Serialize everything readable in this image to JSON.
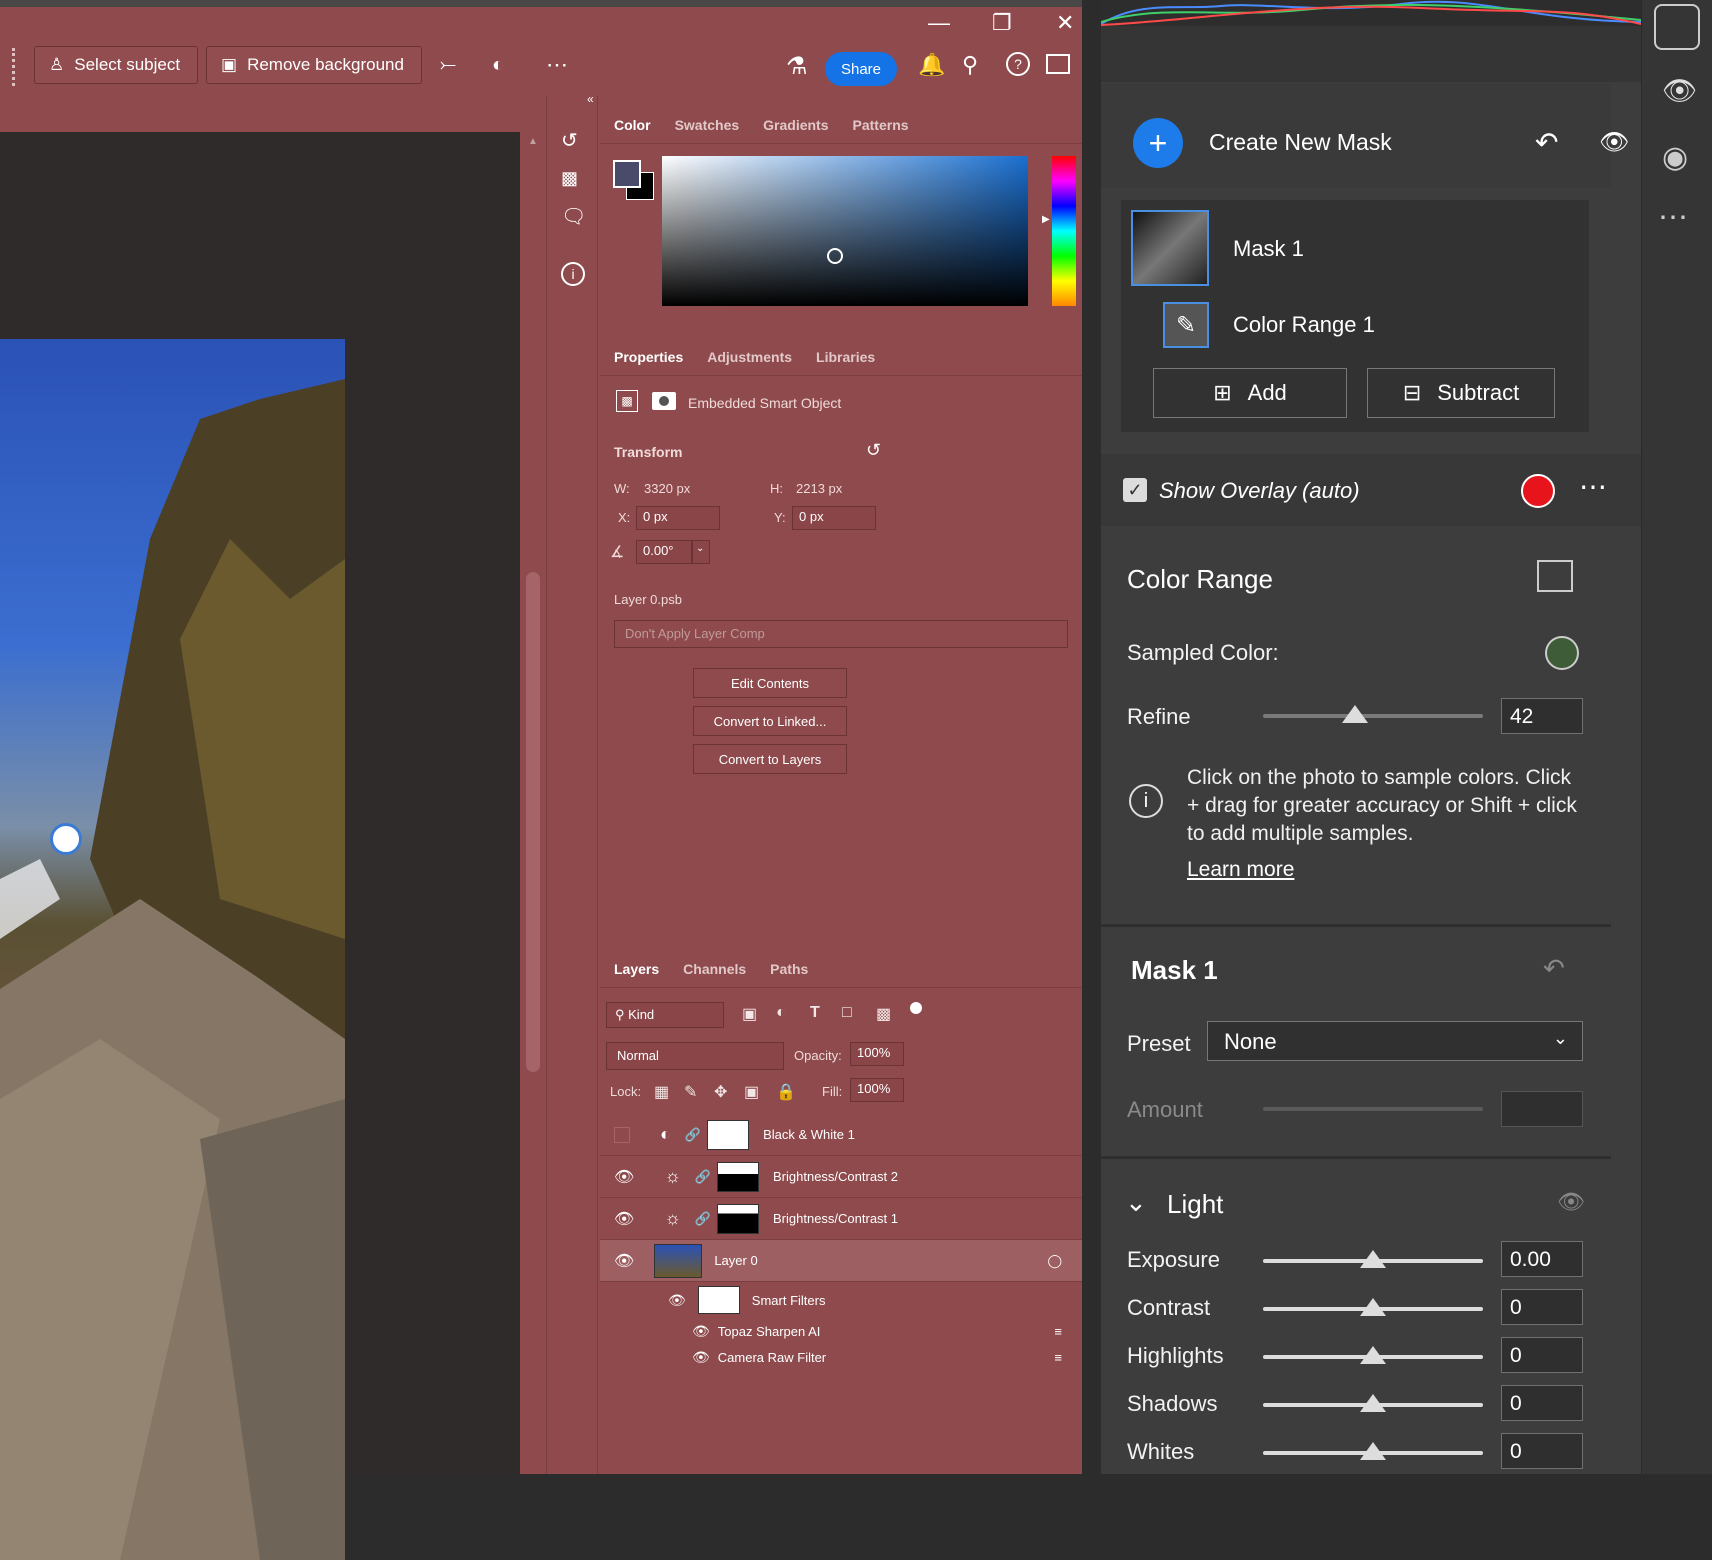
{
  "window": {
    "minimize": "—",
    "restore": "❐",
    "close": "✕"
  },
  "toolbar": {
    "select_subject": "Select subject",
    "remove_background": "Remove background",
    "share": "Share"
  },
  "color_panel": {
    "tabs": [
      "Color",
      "Swatches",
      "Gradients",
      "Patterns"
    ]
  },
  "properties": {
    "tabs": [
      "Properties",
      "Adjustments",
      "Libraries"
    ],
    "type": "Embedded Smart Object",
    "transform_label": "Transform",
    "w_label": "W:",
    "w": "3320 px",
    "h_label": "H:",
    "h": "2213 px",
    "x_label": "X:",
    "x": "0 px",
    "y_label": "Y:",
    "y": "0 px",
    "angle": "0.00°",
    "file": "Layer 0.psb",
    "layer_comp": "Don't Apply Layer Comp",
    "buttons": [
      "Edit Contents",
      "Convert to Linked...",
      "Convert to Layers"
    ]
  },
  "layers": {
    "tabs": [
      "Layers",
      "Channels",
      "Paths"
    ],
    "filter": "Kind",
    "blend": "Normal",
    "opacity_label": "Opacity:",
    "opacity": "100%",
    "lock_label": "Lock:",
    "fill_label": "Fill:",
    "fill": "100%",
    "items": [
      "Black & White 1",
      "Brightness/Contrast 2",
      "Brightness/Contrast 1",
      "Layer 0"
    ],
    "smart_filters": "Smart Filters",
    "filters": [
      "Topaz Sharpen AI",
      "Camera Raw Filter"
    ]
  },
  "camera_raw": {
    "create_mask": "Create New Mask",
    "mask_name": "Mask 1",
    "component": "Color Range 1",
    "add": "Add",
    "subtract": "Subtract",
    "overlay": "Show Overlay (auto)",
    "overlay_color": "#e8141b",
    "color_range_title": "Color Range",
    "sampled_label": "Sampled Color:",
    "sampled_color": "#3f5c38",
    "refine_label": "Refine",
    "refine_value": "42",
    "refine_fraction": 0.42,
    "info": "Click on the photo to sample colors. Click + drag for greater accuracy or Shift + click to add multiple samples.",
    "learn_more": "Learn more",
    "mask_section": "Mask 1",
    "preset_label": "Preset",
    "preset_value": "None",
    "amount_label": "Amount",
    "light_label": "Light",
    "sliders": [
      {
        "label": "Exposure",
        "value": "0.00",
        "fraction": 0.5
      },
      {
        "label": "Contrast",
        "value": "0",
        "fraction": 0.5
      },
      {
        "label": "Highlights",
        "value": "0",
        "fraction": 0.5
      },
      {
        "label": "Shadows",
        "value": "0",
        "fraction": 0.5
      },
      {
        "label": "Whites",
        "value": "0",
        "fraction": 0.5
      }
    ]
  }
}
